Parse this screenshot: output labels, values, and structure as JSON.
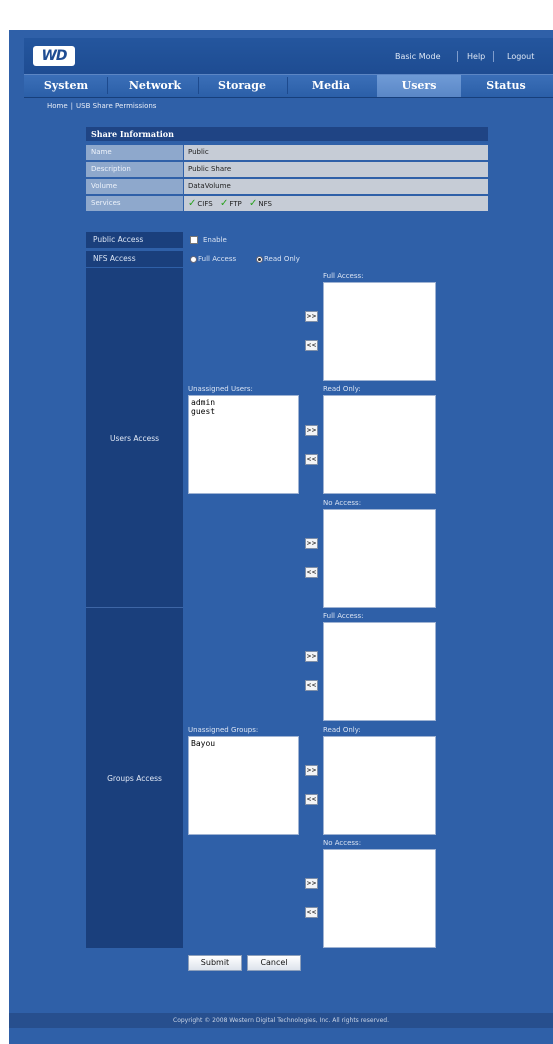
{
  "header": {
    "logo_text": "WD",
    "links": [
      "Basic Mode",
      "Help",
      "Logout"
    ]
  },
  "nav": {
    "tabs": [
      "System",
      "Network",
      "Storage",
      "Media",
      "Users",
      "Status"
    ],
    "active": "Users"
  },
  "breadcrumb": {
    "home": "Home",
    "separator": "|",
    "current": "USB Share Permissions"
  },
  "share_info": {
    "title": "Share Information",
    "rows": [
      {
        "label": "Name",
        "value": "Public"
      },
      {
        "label": "Description",
        "value": "Public Share"
      },
      {
        "label": "Volume",
        "value": "DataVolume"
      },
      {
        "label": "Services",
        "value": ""
      }
    ],
    "services": [
      "CIFS",
      "FTP",
      "NFS"
    ]
  },
  "public_access": {
    "label": "Public Access",
    "enable_label": "Enable",
    "enabled": false
  },
  "nfs_access": {
    "label": "NFS Access",
    "options": [
      "Full Access",
      "Read Only"
    ],
    "selected": "Read Only"
  },
  "users_access": {
    "label": "Users Access",
    "unassigned_label": "Unassigned Users:",
    "unassigned": [
      "admin",
      "guest"
    ],
    "full_access_label": "Full Access:",
    "read_only_label": "Read Only:",
    "no_access_label": "No Access:",
    "full_access": [],
    "read_only": [],
    "no_access": []
  },
  "groups_access": {
    "label": "Groups Access",
    "unassigned_label": "Unassigned Groups:",
    "unassigned": [
      "Bayou"
    ],
    "full_access_label": "Full Access:",
    "read_only_label": "Read Only:",
    "no_access_label": "No Access:",
    "full_access": [],
    "read_only": [],
    "no_access": []
  },
  "move_buttons": {
    "add": ">>",
    "remove": "<<"
  },
  "actions": {
    "submit": "Submit",
    "cancel": "Cancel"
  },
  "footer": {
    "copyright": "Copyright © 2008 Western Digital Technologies, Inc. All rights reserved."
  },
  "colors": {
    "background": "#2f60a8",
    "sidebar": "#1a3f7c",
    "active_tab": "#6f9bd6",
    "check": "#2aa11f"
  }
}
